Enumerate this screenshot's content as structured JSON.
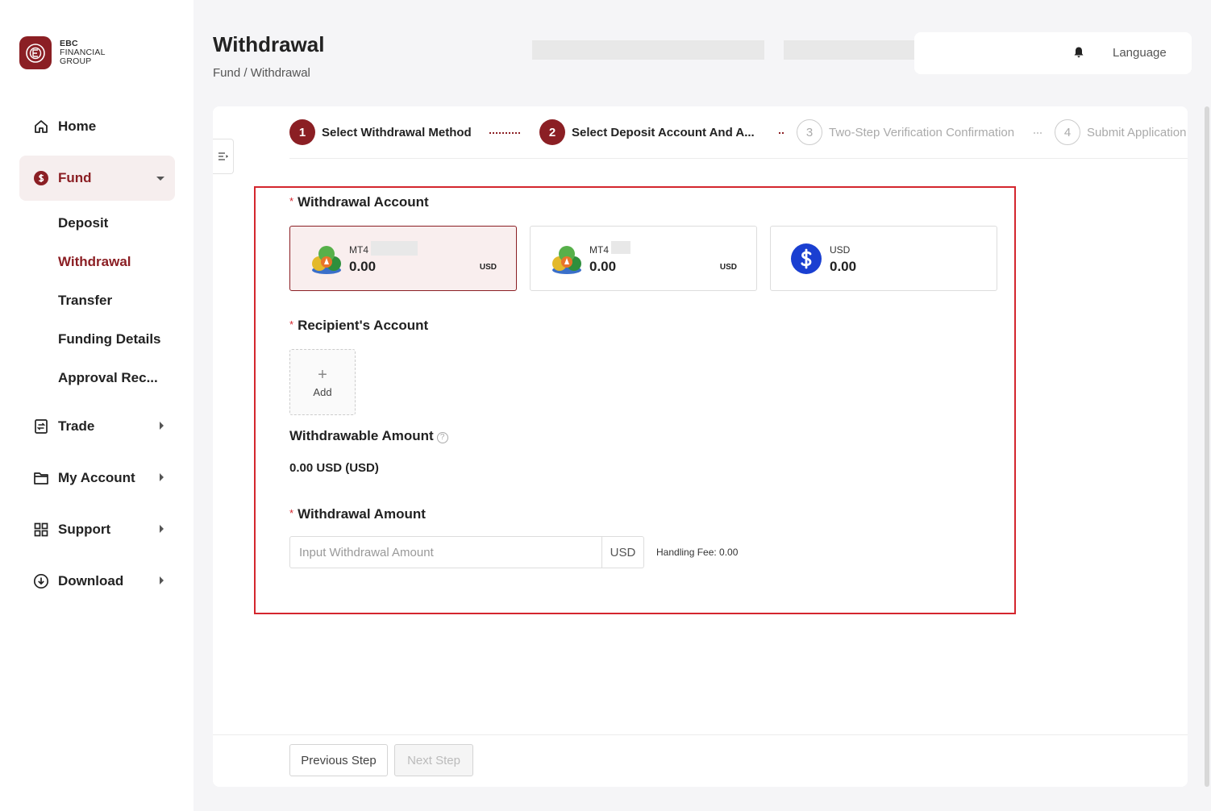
{
  "brand": {
    "line1": "EBC",
    "line2": "FINANCIAL",
    "line3": "GROUP"
  },
  "sidebar": {
    "items": [
      {
        "label": "Home",
        "icon": "home-icon"
      },
      {
        "label": "Fund",
        "icon": "dollar-circle-icon"
      },
      {
        "label": "Trade",
        "icon": "trade-icon"
      },
      {
        "label": "My Account",
        "icon": "folder-icon"
      },
      {
        "label": "Support",
        "icon": "grid-icon"
      },
      {
        "label": "Download",
        "icon": "download-icon"
      }
    ],
    "fund_sub": [
      "Deposit",
      "Withdrawal",
      "Transfer",
      "Funding Details",
      "Approval Rec..."
    ]
  },
  "header": {
    "title": "Withdrawal",
    "breadcrumb": "Fund / Withdrawal",
    "language": "Language"
  },
  "steps": [
    {
      "num": "1",
      "label": "Select Withdrawal Method",
      "state": "done"
    },
    {
      "num": "2",
      "label": "Select Deposit Account And A...",
      "state": "done"
    },
    {
      "num": "3",
      "label": "Two-Step Verification Confirmation",
      "state": "todo"
    },
    {
      "num": "4",
      "label": "Submit Application",
      "state": "todo"
    }
  ],
  "form": {
    "withdrawal_account_label": "Withdrawal Account",
    "accounts": [
      {
        "name": "MT4",
        "balance": "0.00",
        "currency": "USD",
        "icon": "mt4-icon",
        "selected": true
      },
      {
        "name": "MT4",
        "balance": "0.00",
        "currency": "USD",
        "icon": "mt4-icon",
        "selected": false
      },
      {
        "name": "USD",
        "balance": "0.00",
        "currency": "",
        "icon": "dollar-icon",
        "selected": false
      }
    ],
    "recipient_label": "Recipient's Account",
    "add_label": "Add",
    "withdrawable_label": "Withdrawable Amount",
    "withdrawable_value": "0.00 USD (USD)",
    "amount_label": "Withdrawal Amount",
    "amount_placeholder": "Input Withdrawal Amount",
    "amount_value": "",
    "amount_suffix": "USD",
    "handling_fee": "Handling Fee: 0.00",
    "required_mark": "*",
    "help_mark": "?"
  },
  "buttons": {
    "previous": "Previous Step",
    "next": "Next Step"
  },
  "colors": {
    "brand": "#8b1f24",
    "highlight": "#d4262e",
    "usd_icon": "#1a3fd1"
  }
}
